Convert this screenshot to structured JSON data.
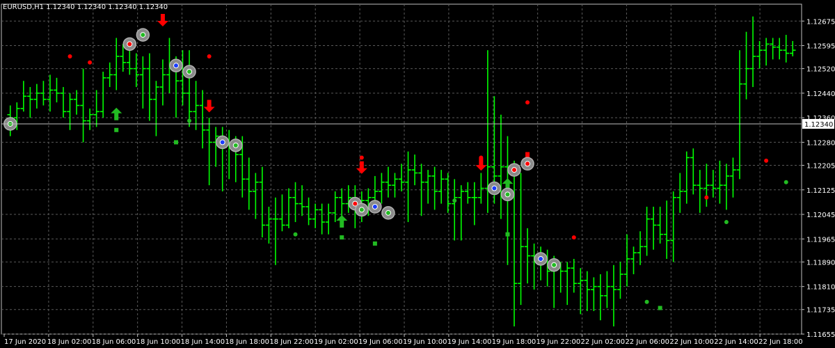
{
  "header": {
    "title": "EURUSD,H1 1.12340 1.12340 1.12340 1.12340"
  },
  "colors": {
    "background": "#000000",
    "grid": "#5a5a5a",
    "axis": "#c0c0c0",
    "bull": "#00ff00",
    "bear": "#00cc00",
    "marker_red": "#ff0000",
    "marker_green": "#22aa22",
    "price_line": "#c0c0c0",
    "text": "#ffffff"
  },
  "chart_data": {
    "type": "ohlc",
    "symbol": "EURUSD",
    "timeframe": "H1",
    "current_price": 1.1234,
    "current_price_label": "1.12340",
    "ylim": [
      1.11655,
      1.1273
    ],
    "y_ticks": [
      "1.12675",
      "1.12595",
      "1.12520",
      "1.12440",
      "1.12360",
      "1.12280",
      "1.12205",
      "1.12125",
      "1.12045",
      "1.11965",
      "1.11890",
      "1.11810",
      "1.11735",
      "1.11655"
    ],
    "x_ticks": [
      "17 Jun 2020",
      "18 Jun 02:00",
      "18 Jun 06:00",
      "18 Jun 10:00",
      "18 Jun 14:00",
      "18 Jun 18:00",
      "18 Jun 22:00",
      "19 Jun 02:00",
      "19 Jun 06:00",
      "19 Jun 10:00",
      "19 Jun 14:00",
      "19 Jun 18:00",
      "19 Jun 22:00",
      "22 Jun 02:00",
      "22 Jun 06:00",
      "22 Jun 10:00",
      "22 Jun 14:00",
      "22 Jun 18:00"
    ],
    "bars": [
      [
        1.1237,
        1.124,
        1.123,
        1.1236
      ],
      [
        1.1236,
        1.1241,
        1.1232,
        1.1239
      ],
      [
        1.1239,
        1.1248,
        1.1238,
        1.1243
      ],
      [
        1.1243,
        1.1246,
        1.1236,
        1.1242
      ],
      [
        1.1242,
        1.1247,
        1.1239,
        1.1244
      ],
      [
        1.1244,
        1.1248,
        1.124,
        1.1242
      ],
      [
        1.1242,
        1.125,
        1.1238,
        1.1245
      ],
      [
        1.1245,
        1.1249,
        1.1241,
        1.1244
      ],
      [
        1.1244,
        1.1246,
        1.1236,
        1.1238
      ],
      [
        1.1238,
        1.1244,
        1.1232,
        1.1242
      ],
      [
        1.1242,
        1.1245,
        1.1237,
        1.124
      ],
      [
        1.124,
        1.1252,
        1.1228,
        1.1235
      ],
      [
        1.1235,
        1.1239,
        1.1232,
        1.1237
      ],
      [
        1.1237,
        1.1245,
        1.1233,
        1.1238
      ],
      [
        1.1238,
        1.1251,
        1.1236,
        1.1249
      ],
      [
        1.1249,
        1.1254,
        1.1246,
        1.125
      ],
      [
        1.125,
        1.1262,
        1.1245,
        1.1256
      ],
      [
        1.1256,
        1.126,
        1.1251,
        1.1254
      ],
      [
        1.1254,
        1.1259,
        1.125,
        1.1252
      ],
      [
        1.1252,
        1.1257,
        1.1246,
        1.125
      ],
      [
        1.125,
        1.1256,
        1.1239,
        1.1252
      ],
      [
        1.1252,
        1.1257,
        1.1235,
        1.1242
      ],
      [
        1.1242,
        1.1248,
        1.123,
        1.1246
      ],
      [
        1.1246,
        1.1255,
        1.124,
        1.125
      ],
      [
        1.125,
        1.1262,
        1.1244,
        1.1252
      ],
      [
        1.1252,
        1.1256,
        1.1236,
        1.1248
      ],
      [
        1.1248,
        1.1258,
        1.124,
        1.1244
      ],
      [
        1.1244,
        1.1258,
        1.1233,
        1.1238
      ],
      [
        1.1238,
        1.1248,
        1.1232,
        1.124
      ],
      [
        1.124,
        1.1245,
        1.1226,
        1.1232
      ],
      [
        1.1232,
        1.1236,
        1.1214,
        1.1228
      ],
      [
        1.1228,
        1.1233,
        1.122,
        1.123
      ],
      [
        1.123,
        1.1233,
        1.1212,
        1.1227
      ],
      [
        1.1227,
        1.1232,
        1.1216,
        1.1226
      ],
      [
        1.1226,
        1.123,
        1.1215,
        1.1224
      ],
      [
        1.1224,
        1.123,
        1.121,
        1.1216
      ],
      [
        1.1216,
        1.1223,
        1.1206,
        1.1212
      ],
      [
        1.1212,
        1.1218,
        1.1203,
        1.1215
      ],
      [
        1.1215,
        1.122,
        1.1197,
        1.1201
      ],
      [
        1.1201,
        1.1207,
        1.1195,
        1.1203
      ],
      [
        1.1203,
        1.121,
        1.1188,
        1.1203
      ],
      [
        1.1203,
        1.1211,
        1.1199,
        1.1201
      ],
      [
        1.1201,
        1.1213,
        1.12,
        1.121
      ],
      [
        1.121,
        1.1215,
        1.1202,
        1.1208
      ],
      [
        1.1208,
        1.1214,
        1.1204,
        1.1207
      ],
      [
        1.1207,
        1.121,
        1.1201,
        1.1203
      ],
      [
        1.1203,
        1.1208,
        1.12,
        1.1206
      ],
      [
        1.1206,
        1.1208,
        1.1198,
        1.1202
      ],
      [
        1.1202,
        1.1208,
        1.1198,
        1.1205
      ],
      [
        1.1205,
        1.1212,
        1.1202,
        1.121
      ],
      [
        1.121,
        1.1213,
        1.1203,
        1.1208
      ],
      [
        1.1208,
        1.1214,
        1.1205,
        1.121
      ],
      [
        1.121,
        1.1214,
        1.12,
        1.1207
      ],
      [
        1.1207,
        1.1212,
        1.1202,
        1.1209
      ],
      [
        1.1209,
        1.1213,
        1.1204,
        1.121
      ],
      [
        1.121,
        1.1217,
        1.1206,
        1.1212
      ],
      [
        1.1212,
        1.1218,
        1.1208,
        1.1215
      ],
      [
        1.1215,
        1.122,
        1.121,
        1.1214
      ],
      [
        1.1214,
        1.1218,
        1.121,
        1.1216
      ],
      [
        1.1216,
        1.1221,
        1.1212,
        1.1215
      ],
      [
        1.1215,
        1.1225,
        1.1202,
        1.1219
      ],
      [
        1.1219,
        1.1224,
        1.1214,
        1.1218
      ],
      [
        1.1218,
        1.1221,
        1.1204,
        1.1215
      ],
      [
        1.1215,
        1.1219,
        1.1208,
        1.1217
      ],
      [
        1.1217,
        1.122,
        1.1206,
        1.1212
      ],
      [
        1.1212,
        1.1219,
        1.1208,
        1.1216
      ],
      [
        1.1216,
        1.1218,
        1.1205,
        1.1208
      ],
      [
        1.1208,
        1.1216,
        1.1196,
        1.121
      ],
      [
        1.121,
        1.1214,
        1.1196,
        1.1212
      ],
      [
        1.1212,
        1.1215,
        1.1208,
        1.121
      ],
      [
        1.121,
        1.1215,
        1.1201,
        1.121
      ],
      [
        1.121,
        1.1218,
        1.1208,
        1.1213
      ],
      [
        1.1213,
        1.1258,
        1.1205,
        1.122
      ],
      [
        1.122,
        1.1243,
        1.1208,
        1.1217
      ],
      [
        1.1217,
        1.1237,
        1.1203,
        1.122
      ],
      [
        1.122,
        1.123,
        1.1188,
        1.121
      ],
      [
        1.121,
        1.1222,
        1.1168,
        1.1182
      ],
      [
        1.1182,
        1.1218,
        1.1175,
        1.1194
      ],
      [
        1.1194,
        1.12,
        1.1182,
        1.1191
      ],
      [
        1.1191,
        1.1195,
        1.118,
        1.1189
      ],
      [
        1.1189,
        1.1194,
        1.1183,
        1.119
      ],
      [
        1.119,
        1.1193,
        1.1181,
        1.1186
      ],
      [
        1.1186,
        1.1191,
        1.1174,
        1.1187
      ],
      [
        1.1187,
        1.1189,
        1.1179,
        1.1186
      ],
      [
        1.1186,
        1.1189,
        1.1175,
        1.1187
      ],
      [
        1.1187,
        1.119,
        1.1179,
        1.1182
      ],
      [
        1.1182,
        1.1187,
        1.1172,
        1.1183
      ],
      [
        1.1183,
        1.1186,
        1.1173,
        1.118
      ],
      [
        1.118,
        1.1184,
        1.1173,
        1.1181
      ],
      [
        1.1181,
        1.1185,
        1.117,
        1.1178
      ],
      [
        1.1178,
        1.1186,
        1.1174,
        1.1181
      ],
      [
        1.1181,
        1.1188,
        1.1168,
        1.118
      ],
      [
        1.118,
        1.1189,
        1.1177,
        1.1185
      ],
      [
        1.1185,
        1.1198,
        1.1181,
        1.119
      ],
      [
        1.119,
        1.1194,
        1.1185,
        1.1192
      ],
      [
        1.1192,
        1.1199,
        1.1188,
        1.1194
      ],
      [
        1.1194,
        1.1207,
        1.1191,
        1.1203
      ],
      [
        1.1203,
        1.1207,
        1.1193,
        1.1201
      ],
      [
        1.1201,
        1.1207,
        1.1195,
        1.1198
      ],
      [
        1.1198,
        1.1209,
        1.119,
        1.1196
      ],
      [
        1.1196,
        1.1212,
        1.1189,
        1.121
      ],
      [
        1.121,
        1.1218,
        1.1205,
        1.1212
      ],
      [
        1.1212,
        1.1225,
        1.1208,
        1.1223
      ],
      [
        1.1223,
        1.1226,
        1.1211,
        1.1214
      ],
      [
        1.1214,
        1.1219,
        1.1205,
        1.1213
      ],
      [
        1.1213,
        1.1221,
        1.1207,
        1.1214
      ],
      [
        1.1214,
        1.1219,
        1.121,
        1.1213
      ],
      [
        1.1213,
        1.1222,
        1.1208,
        1.1214
      ],
      [
        1.1214,
        1.1221,
        1.1206,
        1.1217
      ],
      [
        1.1217,
        1.1223,
        1.121,
        1.1219
      ],
      [
        1.1219,
        1.1258,
        1.1216,
        1.1247
      ],
      [
        1.1247,
        1.1264,
        1.1242,
        1.1252
      ],
      [
        1.1252,
        1.1269,
        1.1246,
        1.1256
      ],
      [
        1.1256,
        1.1261,
        1.1252,
        1.1258
      ],
      [
        1.1258,
        1.1262,
        1.1253,
        1.126
      ],
      [
        1.126,
        1.1262,
        1.1255,
        1.1259
      ],
      [
        1.1259,
        1.1262,
        1.1255,
        1.1258
      ],
      [
        1.1258,
        1.1263,
        1.1254,
        1.1257
      ],
      [
        1.1257,
        1.1261,
        1.1256,
        1.1258
      ]
    ],
    "markers": [
      {
        "type": "circle",
        "bar": 0,
        "price": 1.1234,
        "fill": "gray",
        "inner": "green"
      },
      {
        "type": "dot",
        "bar": 5,
        "price": 1.1256,
        "color": "red"
      },
      {
        "type": "arrow-up",
        "bar": 9,
        "price": 1.1237,
        "color": "green"
      },
      {
        "type": "square",
        "bar": 9,
        "price": 1.1232,
        "color": "green"
      },
      {
        "type": "dot",
        "bar": 7,
        "price": 1.1254,
        "color": "red"
      },
      {
        "type": "circle",
        "bar": 10,
        "price": 1.126,
        "fill": "gray",
        "inner": "red"
      },
      {
        "type": "circle",
        "bar": 11,
        "price": 1.1263,
        "fill": "gray",
        "inner": "green"
      },
      {
        "type": "arrow-down",
        "bar": 13,
        "price": 1.1268,
        "color": "red"
      },
      {
        "type": "square",
        "bar": 14,
        "price": 1.1228,
        "color": "green"
      },
      {
        "type": "circle",
        "bar": 14,
        "price": 1.1253,
        "fill": "gray",
        "inner": "blue"
      },
      {
        "type": "circle",
        "bar": 15,
        "price": 1.1251,
        "fill": "gray",
        "inner": "green"
      },
      {
        "type": "dot",
        "bar": 15,
        "price": 1.1235,
        "color": "green"
      },
      {
        "type": "dot",
        "bar": 17,
        "price": 1.1256,
        "color": "red"
      },
      {
        "type": "arrow-down",
        "bar": 17,
        "price": 1.124,
        "color": "red"
      },
      {
        "type": "circle",
        "bar": 18,
        "price": 1.1228,
        "fill": "gray",
        "inner": "blue"
      },
      {
        "type": "circle",
        "bar": 19,
        "price": 1.1227,
        "fill": "gray",
        "inner": "green"
      },
      {
        "type": "dot",
        "bar": 24,
        "price": 1.1198,
        "color": "green"
      },
      {
        "type": "arrow-up",
        "bar": 28,
        "price": 1.1202,
        "color": "green"
      },
      {
        "type": "square",
        "bar": 28,
        "price": 1.1197,
        "color": "green"
      },
      {
        "type": "circle",
        "bar": 29,
        "price": 1.1208,
        "fill": "gray",
        "inner": "red"
      },
      {
        "type": "arrow-down",
        "bar": 30,
        "price": 1.122,
        "color": "red"
      },
      {
        "type": "dot",
        "bar": 30,
        "price": 1.1223,
        "color": "red"
      },
      {
        "type": "circle",
        "bar": 30,
        "price": 1.1206,
        "fill": "gray",
        "inner": "green"
      },
      {
        "type": "circle",
        "bar": 31,
        "price": 1.1207,
        "fill": "gray",
        "inner": "blue"
      },
      {
        "type": "square",
        "bar": 31,
        "price": 1.1195,
        "color": "green"
      },
      {
        "type": "circle",
        "bar": 32,
        "price": 1.1205,
        "fill": "gray",
        "inner": "green"
      },
      {
        "type": "dot",
        "bar": 38,
        "price": 1.1209,
        "color": "green"
      },
      {
        "type": "arrow-down",
        "bar": 40,
        "price": 1.1221,
        "color": "red"
      },
      {
        "type": "dot",
        "bar": 40,
        "price": 1.1223,
        "color": "red"
      },
      {
        "type": "circle",
        "bar": 41,
        "price": 1.1213,
        "fill": "gray",
        "inner": "blue"
      },
      {
        "type": "arrow-up",
        "bar": 42,
        "price": 1.1214,
        "color": "green"
      },
      {
        "type": "circle",
        "bar": 42,
        "price": 1.1211,
        "fill": "gray",
        "inner": "green"
      },
      {
        "type": "square",
        "bar": 42,
        "price": 1.1198,
        "color": "green"
      },
      {
        "type": "circle",
        "bar": 43,
        "price": 1.1219,
        "fill": "gray",
        "inner": "red"
      },
      {
        "type": "dot",
        "bar": 44,
        "price": 1.1241,
        "color": "red"
      },
      {
        "type": "arrow-down",
        "bar": 44,
        "price": 1.1223,
        "color": "red"
      },
      {
        "type": "circle",
        "bar": 44,
        "price": 1.1221,
        "fill": "gray",
        "inner": "red"
      },
      {
        "type": "circle",
        "bar": 45,
        "price": 1.119,
        "fill": "gray",
        "inner": "blue"
      },
      {
        "type": "circle",
        "bar": 46,
        "price": 1.1188,
        "fill": "gray",
        "inner": "green"
      },
      {
        "type": "dot",
        "bar": 48,
        "price": 1.1197,
        "color": "red"
      },
      {
        "type": "dot",
        "bar": 54,
        "price": 1.1176,
        "color": "green"
      },
      {
        "type": "square",
        "bar": 55,
        "price": 1.1174,
        "color": "green"
      },
      {
        "type": "dot",
        "bar": 59,
        "price": 1.121,
        "color": "red"
      },
      {
        "type": "dot",
        "bar": 61,
        "price": 1.1202,
        "color": "green"
      },
      {
        "type": "dot",
        "bar": 64,
        "price": 1.1222,
        "color": "red"
      },
      {
        "type": "dot",
        "bar": 66,
        "price": 1.1215,
        "color": "green"
      }
    ]
  }
}
